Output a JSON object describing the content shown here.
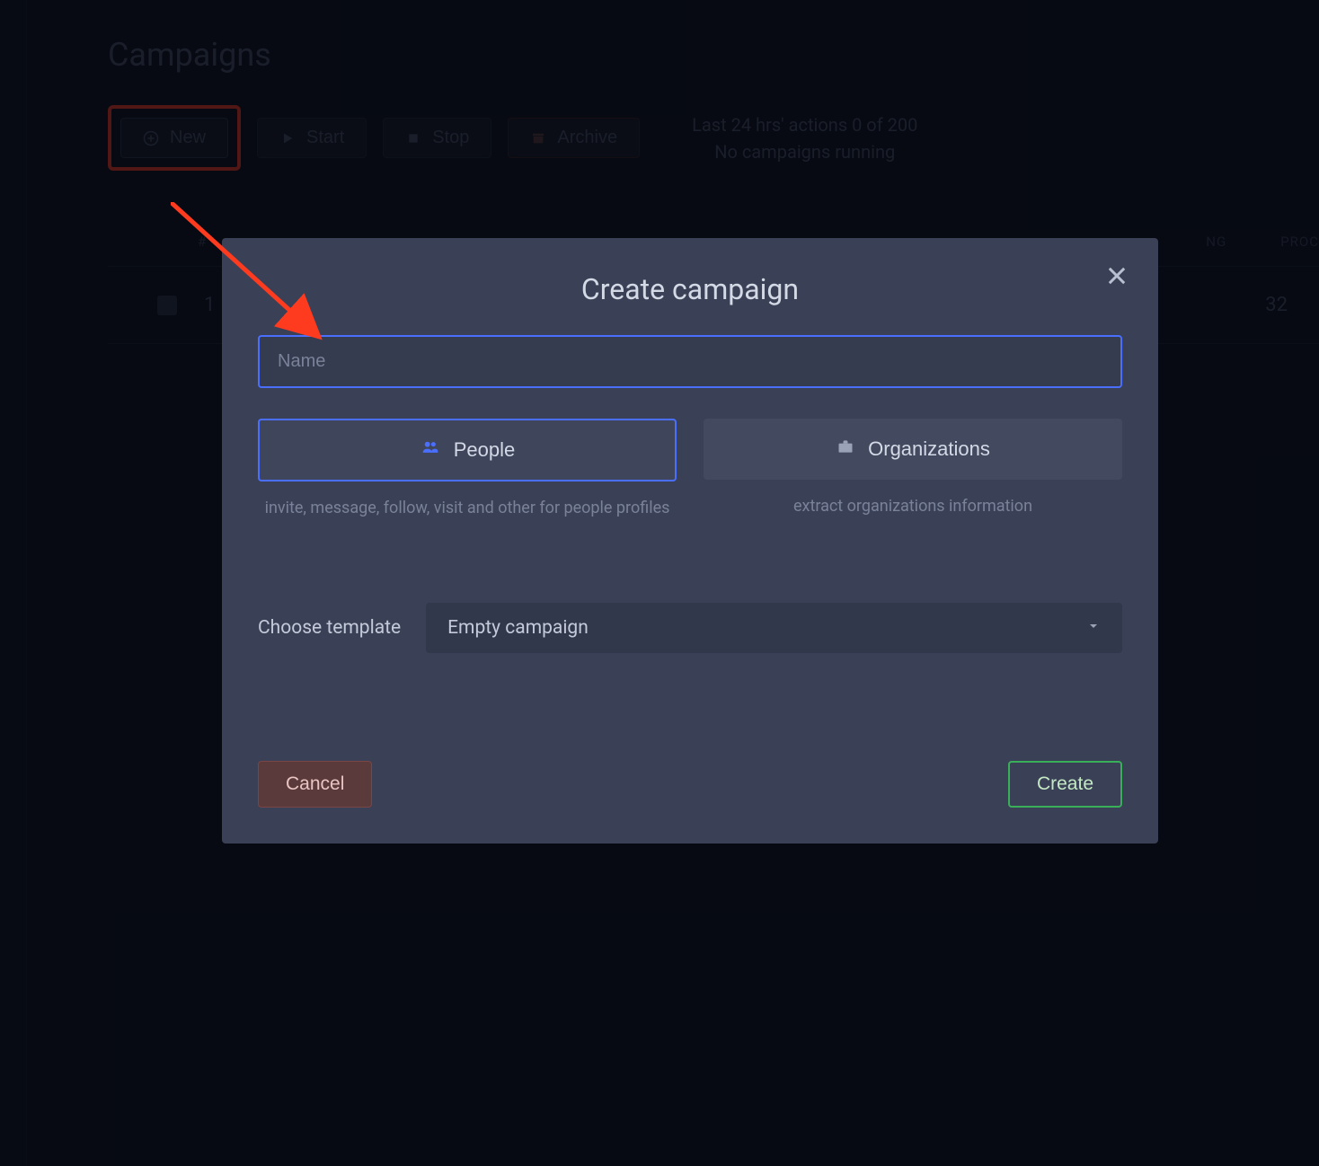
{
  "page": {
    "title": "Campaigns"
  },
  "toolbar": {
    "new_label": "New",
    "start_label": "Start",
    "stop_label": "Stop",
    "archive_label": "Archive"
  },
  "status": {
    "line1": "Last 24 hrs' actions 0 of 200",
    "line2": "No campaigns running"
  },
  "table": {
    "headers": {
      "hash": "#",
      "ng": "NG",
      "proc": "PROC"
    },
    "rows": [
      {
        "num": "1",
        "value": "32"
      }
    ]
  },
  "modal": {
    "title": "Create campaign",
    "name_placeholder": "Name",
    "types": {
      "people": {
        "label": "People",
        "description": "invite, message, follow, visit and other for people profiles"
      },
      "organizations": {
        "label": "Organizations",
        "description": "extract organizations information"
      }
    },
    "template_label": "Choose template",
    "template_value": "Empty campaign",
    "cancel_label": "Cancel",
    "create_label": "Create"
  }
}
